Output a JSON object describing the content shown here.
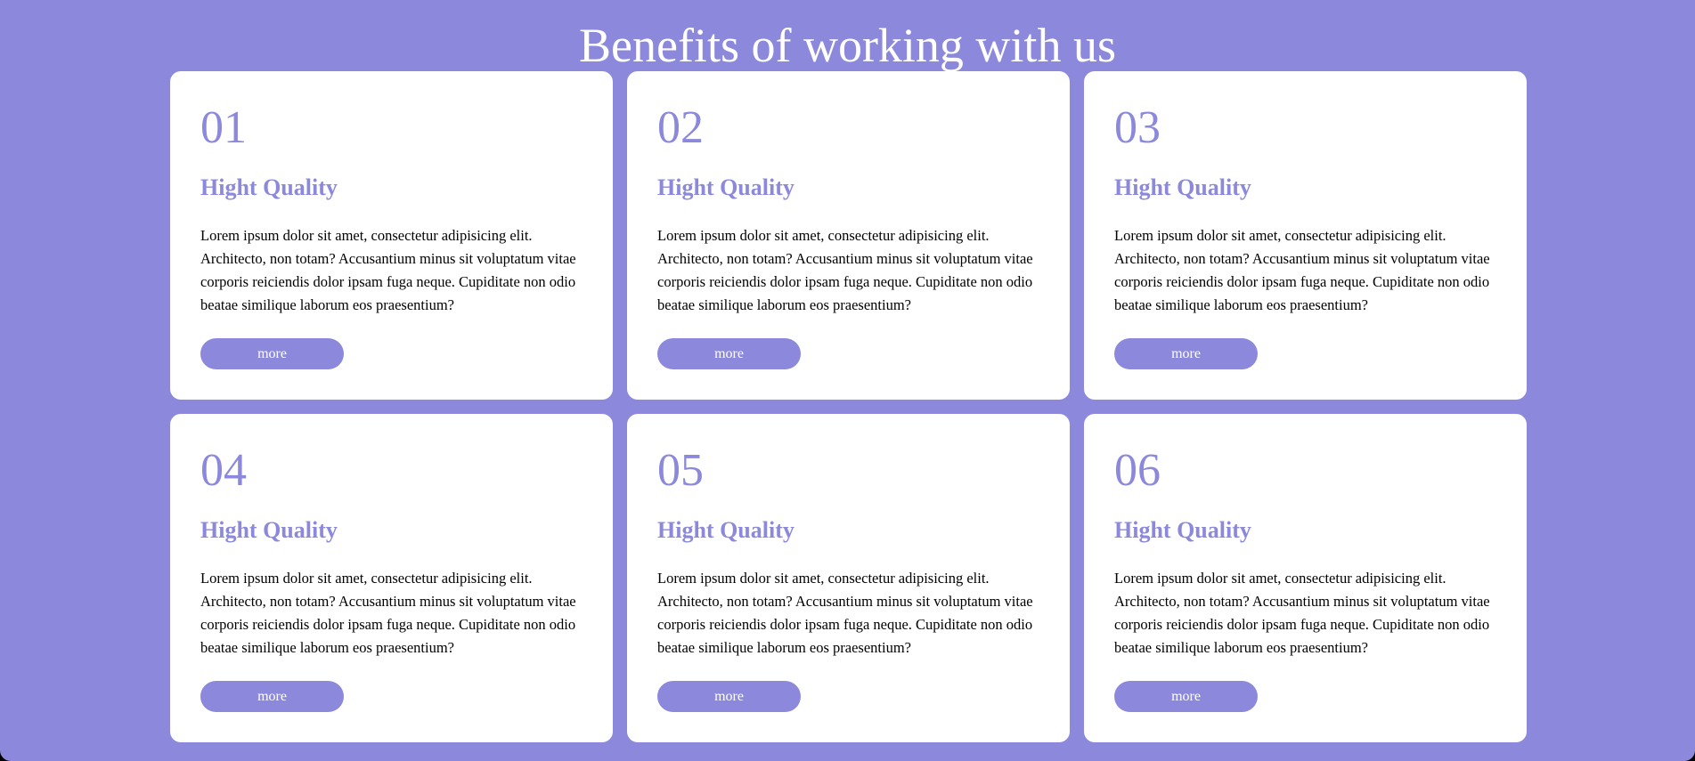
{
  "page": {
    "title": "Benefits of working with us"
  },
  "cards": [
    {
      "number": "01",
      "heading": "Hight Quality",
      "text": "Lorem ipsum dolor sit amet, consectetur adipisicing elit. Architecto, non totam? Accusantium minus sit voluptatum vitae corporis reiciendis dolor ipsam fuga neque. Cupiditate non odio beatae similique laborum eos praesentium?",
      "button_label": "more"
    },
    {
      "number": "02",
      "heading": "Hight Quality",
      "text": "Lorem ipsum dolor sit amet, consectetur adipisicing elit. Architecto, non totam? Accusantium minus sit voluptatum vitae corporis reiciendis dolor ipsam fuga neque. Cupiditate non odio beatae similique laborum eos praesentium?",
      "button_label": "more"
    },
    {
      "number": "03",
      "heading": "Hight Quality",
      "text": "Lorem ipsum dolor sit amet, consectetur adipisicing elit. Architecto, non totam? Accusantium minus sit voluptatum vitae corporis reiciendis dolor ipsam fuga neque. Cupiditate non odio beatae similique laborum eos praesentium?",
      "button_label": "more"
    },
    {
      "number": "04",
      "heading": "Hight Quality",
      "text": "Lorem ipsum dolor sit amet, consectetur adipisicing elit. Architecto, non totam? Accusantium minus sit voluptatum vitae corporis reiciendis dolor ipsam fuga neque. Cupiditate non odio beatae similique laborum eos praesentium?",
      "button_label": "more"
    },
    {
      "number": "05",
      "heading": "Hight Quality",
      "text": "Lorem ipsum dolor sit amet, consectetur adipisicing elit. Architecto, non totam? Accusantium minus sit voluptatum vitae corporis reiciendis dolor ipsam fuga neque. Cupiditate non odio beatae similique laborum eos praesentium?",
      "button_label": "more"
    },
    {
      "number": "06",
      "heading": "Hight Quality",
      "text": "Lorem ipsum dolor sit amet, consectetur adipisicing elit. Architecto, non totam? Accusantium minus sit voluptatum vitae corporis reiciendis dolor ipsam fuga neque. Cupiditate non odio beatae similique laborum eos praesentium?",
      "button_label": "more"
    }
  ],
  "colors": {
    "background": "#8c89dd",
    "card": "#ffffff",
    "accent": "#8c89dd",
    "text": "#000000"
  }
}
